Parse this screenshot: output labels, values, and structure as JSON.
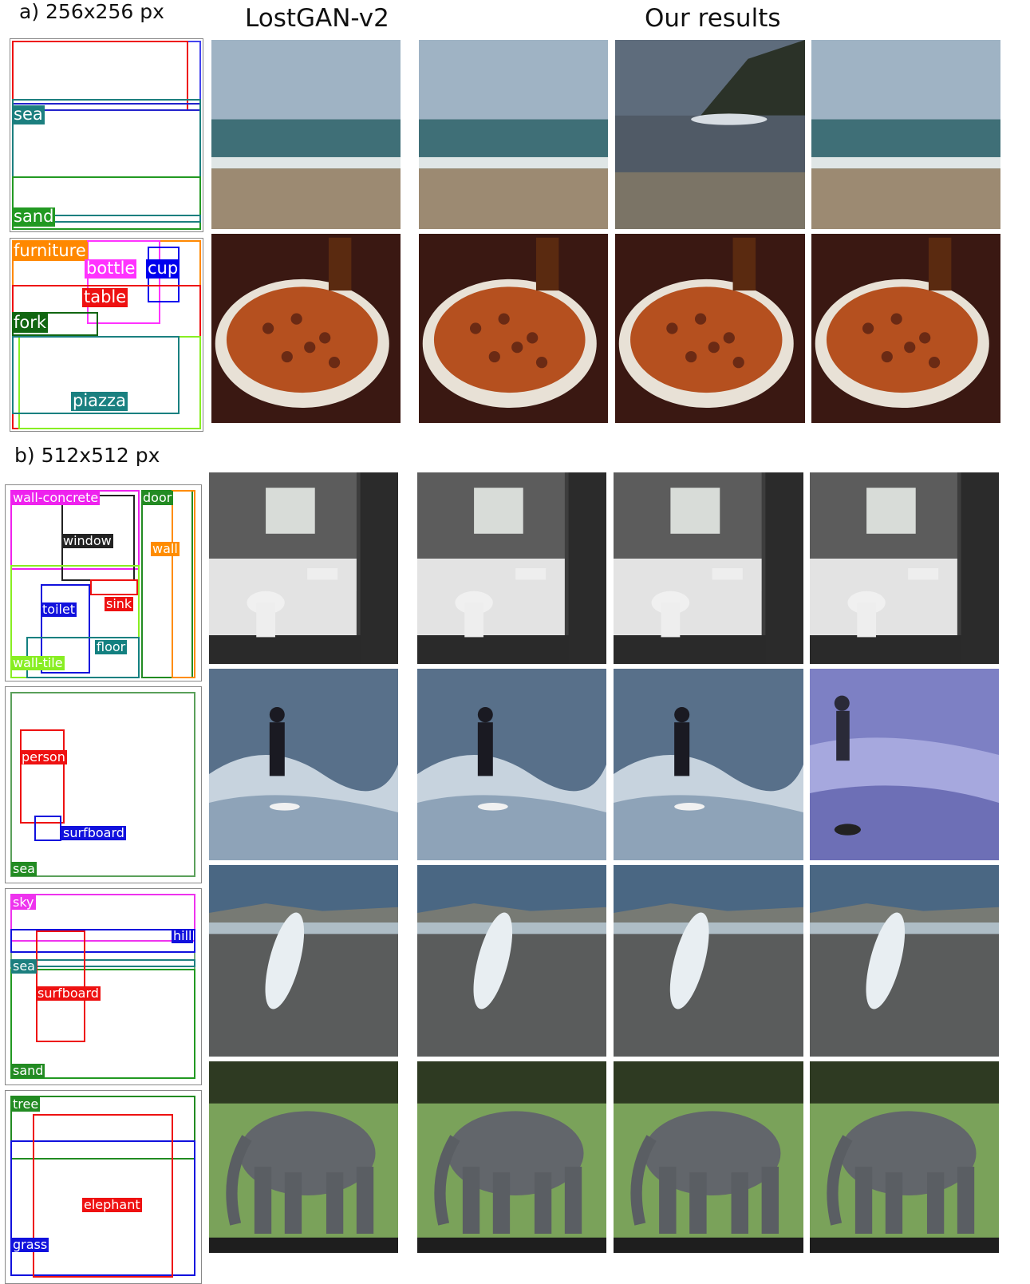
{
  "headers": {
    "section_a": "a) 256x256 px",
    "section_b": "b) 512x512 px",
    "col_baseline": "LostGAN-v2",
    "col_ours": "Our results"
  },
  "colors": {
    "sea": "#1c7f7f",
    "sand": "#229922",
    "furniture": "#ff8800",
    "bottle": "#ff33ff",
    "cup": "#0000ee",
    "table": "#ee1111",
    "fork": "#116611",
    "piazza": "#1a8080",
    "wall_concrete": "#ee22ee",
    "door": "#228b22",
    "window": "#222222",
    "wall": "#ff8c00",
    "toilet": "#1111dd",
    "sink": "#ee1111",
    "floor": "#138080",
    "wall_tile": "#88ee22",
    "person": "#ee1111",
    "surfboard_blue": "#1111dd",
    "sky": "#ee33ee",
    "hill": "#1111dd",
    "tree": "#228b22",
    "elephant": "#ee1111",
    "grass": "#1111dd"
  },
  "rows": [
    {
      "id": "beach-256",
      "labels": {
        "sea": "sea",
        "sand": "sand"
      },
      "images": [
        {
          "name": "lostgan-beach-image",
          "scene": "beach"
        },
        {
          "name": "ours-beach-image-1",
          "scene": "beach"
        },
        {
          "name": "ours-beach-image-2",
          "scene": "beach-cliff"
        },
        {
          "name": "ours-beach-image-3",
          "scene": "beach"
        }
      ]
    },
    {
      "id": "pizza-256",
      "labels": {
        "furniture": "furniture",
        "bottle": "bottle",
        "cup": "cup",
        "table": "table",
        "fork": "fork",
        "piazza": "piazza"
      },
      "images": [
        {
          "name": "lostgan-pizza-image",
          "scene": "pizza"
        },
        {
          "name": "ours-pizza-image-1",
          "scene": "pizza"
        },
        {
          "name": "ours-pizza-image-2",
          "scene": "pizza"
        },
        {
          "name": "ours-pizza-image-3",
          "scene": "pizza"
        }
      ]
    },
    {
      "id": "bathroom-512",
      "labels": {
        "wall_concrete": "wall-concrete",
        "door": "door",
        "window": "window",
        "wall": "wall",
        "toilet": "toilet",
        "sink": "sink",
        "floor": "floor",
        "wall_tile": "wall-tile"
      },
      "images": [
        {
          "name": "lostgan-bathroom-image",
          "scene": "bathroom"
        },
        {
          "name": "ours-bathroom-image-1",
          "scene": "bathroom"
        },
        {
          "name": "ours-bathroom-image-2",
          "scene": "bathroom"
        },
        {
          "name": "ours-bathroom-image-3",
          "scene": "bathroom"
        }
      ]
    },
    {
      "id": "surfer-512",
      "labels": {
        "person": "person",
        "surfboard": "surfboard",
        "sea": "sea"
      },
      "images": [
        {
          "name": "lostgan-surfer-image",
          "scene": "surfer"
        },
        {
          "name": "ours-surfer-image-1",
          "scene": "surfer"
        },
        {
          "name": "ours-surfer-image-2",
          "scene": "surfer"
        },
        {
          "name": "ours-surfer-image-3",
          "scene": "surfer-purple"
        }
      ]
    },
    {
      "id": "surfboard-beach-512",
      "labels": {
        "sky": "sky",
        "hill": "hill",
        "sea": "sea",
        "surfboard": "surfboard",
        "sand": "sand"
      },
      "images": [
        {
          "name": "lostgan-surfboard-beach-image",
          "scene": "surfboard-beach"
        },
        {
          "name": "ours-surfboard-beach-image-1",
          "scene": "surfboard-beach"
        },
        {
          "name": "ours-surfboard-beach-image-2",
          "scene": "surfboard-beach"
        },
        {
          "name": "ours-surfboard-beach-image-3",
          "scene": "surfboard-beach"
        }
      ]
    },
    {
      "id": "elephant-512",
      "labels": {
        "tree": "tree",
        "elephant": "elephant",
        "grass": "grass"
      },
      "images": [
        {
          "name": "lostgan-elephant-image",
          "scene": "elephant"
        },
        {
          "name": "ours-elephant-image-1",
          "scene": "elephant"
        },
        {
          "name": "ours-elephant-image-2",
          "scene": "elephant"
        },
        {
          "name": "ours-elephant-image-3",
          "scene": "elephant"
        }
      ]
    }
  ]
}
